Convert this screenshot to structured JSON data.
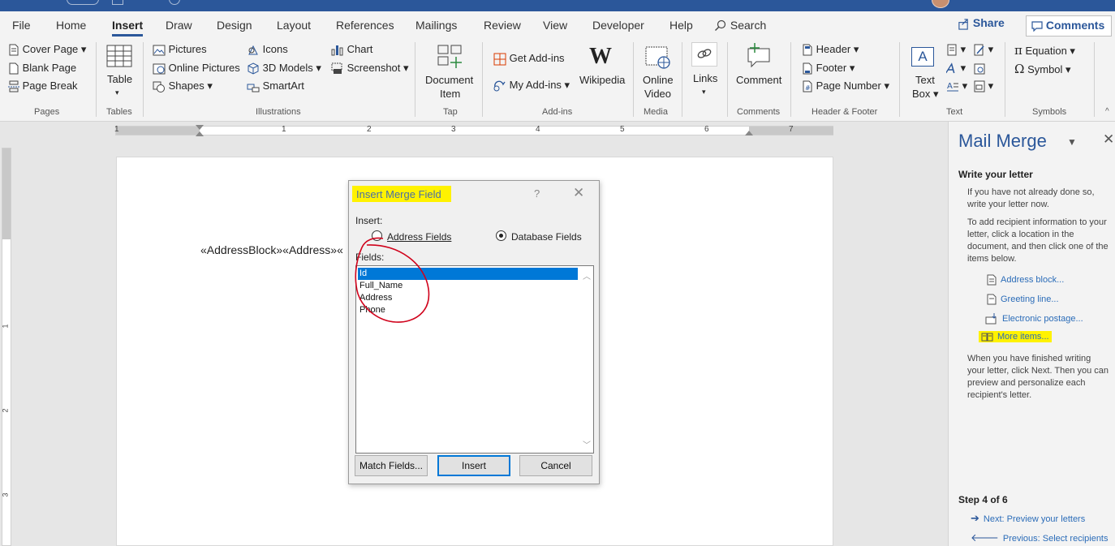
{
  "menu": {
    "tabs": [
      "File",
      "Home",
      "Insert",
      "Draw",
      "Design",
      "Layout",
      "References",
      "Mailings",
      "Review",
      "View",
      "Developer",
      "Help"
    ],
    "active_tab": "Insert",
    "search_label": "Search",
    "share_label": "Share",
    "comments_label": "Comments"
  },
  "ribbon": {
    "pages": {
      "cover_page": "Cover Page",
      "blank_page": "Blank Page",
      "page_break": "Page Break",
      "label": "Pages"
    },
    "tables": {
      "table": "Table",
      "label": "Tables"
    },
    "illustrations": {
      "pictures": "Pictures",
      "online_pictures": "Online Pictures",
      "shapes": "Shapes",
      "icons": "Icons",
      "models_3d": "3D Models",
      "smartart": "SmartArt",
      "chart": "Chart",
      "screenshot": "Screenshot",
      "label": "Illustrations"
    },
    "tap": {
      "document_item_1": "Document",
      "document_item_2": "Item",
      "label": "Tap"
    },
    "addins": {
      "get_addins": "Get Add-ins",
      "my_addins": "My Add-ins",
      "wikipedia": "Wikipedia",
      "label": "Add-ins"
    },
    "media": {
      "online_video_1": "Online",
      "online_video_2": "Video",
      "label": "Media"
    },
    "links": {
      "links": "Links"
    },
    "comments": {
      "comment": "Comment",
      "label": "Comments"
    },
    "header_footer": {
      "header": "Header",
      "footer": "Footer",
      "page_number": "Page Number",
      "label": "Header & Footer"
    },
    "text": {
      "text_box_1": "Text",
      "text_box_2": "Box",
      "label": "Text"
    },
    "symbols": {
      "equation": "Equation",
      "symbol": "Symbol",
      "label": "Symbols"
    }
  },
  "ruler": {
    "numbers": [
      "1",
      "1",
      "2",
      "3",
      "4",
      "5",
      "6",
      "7"
    ],
    "vnumbers": [
      "1",
      "2",
      "3"
    ]
  },
  "document": {
    "merge_text": "«AddressBlock»«Address»«"
  },
  "dialog": {
    "title": "Insert Merge Field",
    "help": "?",
    "insert_label": "Insert:",
    "address_fields": "Address Fields",
    "database_fields": "Database Fields",
    "fields_label": "Fields:",
    "fields": [
      "Id",
      "Full_Name",
      "Address",
      "Phone"
    ],
    "selected_field": "Id",
    "match_fields": "Match Fields...",
    "insert_btn": "Insert",
    "cancel_btn": "Cancel"
  },
  "pane": {
    "title": "Mail Merge",
    "section_title": "Write your letter",
    "text1": "If you have not already done so, write your letter now.",
    "text2": "To add recipient information to your letter, click a location in the document, and then click one of the items below.",
    "links": [
      "Address block...",
      "Greeting line...",
      "Electronic postage...",
      "More items..."
    ],
    "text3": "When you have finished writing your letter, click Next. Then you can preview and personalize each recipient's letter.",
    "step": "Step 4 of 6",
    "next": "Next: Preview your letters",
    "previous": "Previous: Select recipients"
  },
  "colors": {
    "word_blue": "#2b579a",
    "highlight": "#fff200",
    "selection": "#0078d7",
    "annotation_red": "#d0021b"
  }
}
